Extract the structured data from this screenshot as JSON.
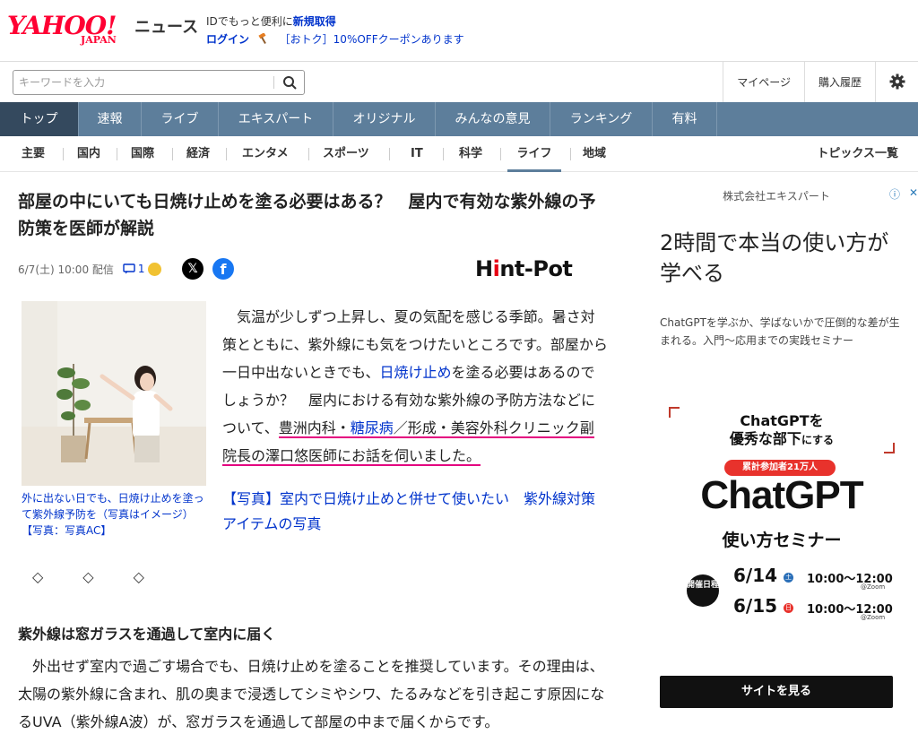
{
  "header": {
    "logo": "YAHOO! JAPAN",
    "logo_main": "YAHOO!",
    "logo_sub": "JAPAN",
    "section": "ニュース",
    "promo_line1_prefix": "IDでもっと便利に",
    "promo_signup": "新規取得",
    "promo_login": "ログイン",
    "promo_deal": "［おトク］10%OFFクーポンあります"
  },
  "search": {
    "placeholder": "キーワードを入力",
    "icon": "search-icon"
  },
  "top_links": [
    "マイページ",
    "購入履歴"
  ],
  "main_nav": [
    "トップ",
    "速報",
    "ライブ",
    "エキスパート",
    "オリジナル",
    "みんなの意見",
    "ランキング",
    "有料"
  ],
  "main_nav_active": "トップ",
  "sub_nav": [
    "主要",
    "国内",
    "国際",
    "経済",
    "エンタメ",
    "スポーツ",
    "IT",
    "科学",
    "ライフ",
    "地域"
  ],
  "sub_nav_active": "ライフ",
  "topics_link": "トピックス一覧",
  "article": {
    "title": "部屋の中にいても日焼け止めを塗る必要はある？　屋内で有効な紫外線の予防策を医師が解説",
    "date": "6/7(土) 10:00",
    "date_suffix": "配信",
    "comment_count": "1",
    "source_logo": "Hint-Pot",
    "source_logo_a": "H",
    "source_logo_b": "i",
    "source_logo_c": "nt-Pot",
    "photo_caption": "外に出ない日でも、日焼け止めを塗って紫外線予防を（写真はイメージ）【写真：写真AC】",
    "body_part1": "　気温が少しずつ上昇し、夏の気配を感じる季節。暑さ対策とともに、紫外線にも気をつけたいところです。部屋から一日中出ないときでも、",
    "body_link1": "日焼け止め",
    "body_part2": "を塗る必要はあるのでしょうか？　屋内における有効な紫外線の予防方法などについて、",
    "body_link2": "豊洲内科・",
    "body_link3": "糖尿病",
    "body_part3": "／形成・美容外科クリニック副院長の澤口悠医師にお話を伺いました。",
    "photo_link": "【写真】室内で日焼け止めと併せて使いたい　紫外線対策アイテムの写真",
    "divider": "◇　◇　◇",
    "section_heading": "紫外線は窓ガラスを通過して室内に届く",
    "para2": "　外出せず室内で過ごす場合でも、日焼け止めを塗ることを推奨しています。その理由は、太陽の紫外線に含まれ、肌の奥まで浸透してシミやシワ、たるみなどを引き起こす原因になるUVA（紫外線A波）が、窓ガラスを通過して部屋の中まで届くからです。"
  },
  "ad": {
    "sponsor": "株式会社エキスパート",
    "info_icon": "ⓘ",
    "close_icon": "✕",
    "headline": "2時間で本当の使い方が学べる",
    "description": "ChatGPTを学ぶか、学ばないかで圧倒的な差が生まれる。入門〜応用までの実践セミナー",
    "banner_line1": "ChatGPTを",
    "banner_line2a": "優秀な部下",
    "banner_line2b": "にする",
    "banner_pill": "累計参加者21万人",
    "banner_big": "ChatGPT",
    "banner_sub": "使い方セミナー",
    "banner_schedule_label": "開催日程",
    "dates": [
      {
        "date": "6/14",
        "dow": "土",
        "time": "10:00〜12:00",
        "via": "@Zoom",
        "dow_color": "#2a6fb8"
      },
      {
        "date": "6/15",
        "dow": "日",
        "time": "10:00〜12:00",
        "via": "@Zoom",
        "dow_color": "#e8322c"
      }
    ],
    "cta": "サイトを見る"
  },
  "colors": {
    "brand_red": "#ff0033",
    "nav_bg": "#5d7e9b",
    "nav_active": "#34495e",
    "link_blue": "#0033cc",
    "highlight_underline": "#e4007f"
  }
}
